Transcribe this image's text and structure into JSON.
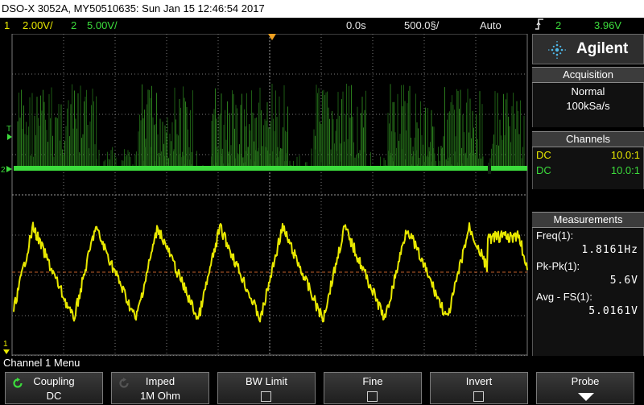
{
  "title_bar": {
    "text": "DSO-X 3052A, MY50510635: Sun Jan 15 12:46:54 2017"
  },
  "status": {
    "ch1_num": "1",
    "ch1_scale": "2.00V/",
    "ch2_num": "2",
    "ch2_scale": "5.00V/",
    "time_delay": "0.0s",
    "time_scale": "500.0§/",
    "trigger_mode": "Auto",
    "trigger_icon": "trigger-edge-icon",
    "trigger_source": "2",
    "trigger_level": "3.96V"
  },
  "markers": {
    "trigger_level_label": "T",
    "ch2_label": "2",
    "ch1_label": "1"
  },
  "brand": {
    "name": "Agilent",
    "logo_icon": "agilent-spark-icon"
  },
  "acquisition": {
    "header": "Acquisition",
    "mode": "Normal",
    "rate": "100kSa/s"
  },
  "channels": {
    "header": "Channels",
    "rows": [
      {
        "coupling": "DC",
        "probe": "10.0:1",
        "color": "#e8e800"
      },
      {
        "coupling": "DC",
        "probe": "10.0:1",
        "color": "#3cdc3c"
      }
    ]
  },
  "measurements": {
    "header": "Measurements",
    "items": [
      {
        "label": "Freq(1):",
        "value": "1.8161Hz"
      },
      {
        "label": "Pk-Pk(1):",
        "value": "5.6V"
      },
      {
        "label": "Avg - FS(1):",
        "value": "5.0161V"
      }
    ]
  },
  "menu": {
    "label": "Channel 1 Menu"
  },
  "softkeys": [
    {
      "title": "Coupling",
      "value": "DC",
      "icon": "rotate-knob-icon"
    },
    {
      "title": "Imped",
      "value": "1M Ohm",
      "icon": "rotate-knob-icon"
    },
    {
      "title": "BW Limit",
      "value": ""
    },
    {
      "title": "Fine",
      "value": ""
    },
    {
      "title": "Invert",
      "value": ""
    },
    {
      "title": "Probe",
      "value": "",
      "icon": "arrow-down-icon"
    }
  ],
  "colors": {
    "channel1": "#e8e800",
    "channel2": "#3cdc3c",
    "channel2_dim": "#1d5a14",
    "trigger": "#f0a020",
    "grid": "#808080",
    "ref_line": "#c0602a"
  }
}
